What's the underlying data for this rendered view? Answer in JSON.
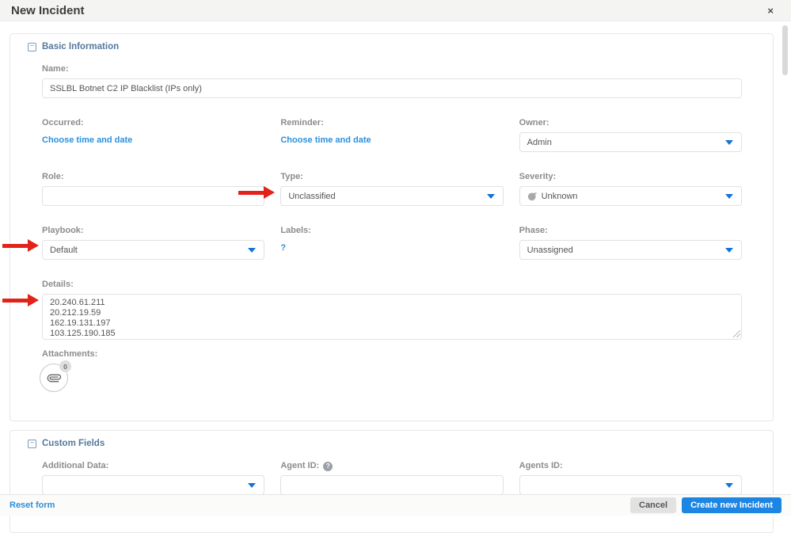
{
  "dialog": {
    "title": "New Incident",
    "close_icon": "×"
  },
  "basic_info": {
    "title": "Basic Information",
    "collapse_icon": "−",
    "name_label": "Name:",
    "name_value": "SSLBL Botnet C2 IP Blacklist (IPs only)",
    "occurred_label": "Occurred:",
    "occurred_link": "Choose time and date",
    "reminder_label": "Reminder:",
    "reminder_link": "Choose time and date",
    "owner_label": "Owner:",
    "owner_value": "Admin",
    "role_label": "Role:",
    "role_value": "",
    "type_label": "Type:",
    "type_value": "Unclassified",
    "severity_label": "Severity:",
    "severity_value": "Unknown",
    "playbook_label": "Playbook:",
    "playbook_value": "Default",
    "labels_label": "Labels:",
    "labels_link": "?",
    "phase_label": "Phase:",
    "phase_value": "Unassigned",
    "details_label": "Details:",
    "details_value": "20.240.61.211\n20.212.19.59\n162.19.131.197\n103.125.190.185",
    "attachments_label": "Attachments:",
    "attachments_count": "0"
  },
  "custom_fields": {
    "title": "Custom Fields",
    "collapse_icon": "−",
    "additional_data_label": "Additional Data:",
    "agent_id_label": "Agent ID:",
    "agent_id_help": "?",
    "agents_id_label": "Agents ID:"
  },
  "footer": {
    "reset_label": "Reset form",
    "cancel_label": "Cancel",
    "create_label": "Create new Incident"
  },
  "colors": {
    "accent_blue": "#1d86e3",
    "link_blue": "#2b90da",
    "section_header_blue": "#56789d",
    "arrow_red": "#e2231a"
  }
}
